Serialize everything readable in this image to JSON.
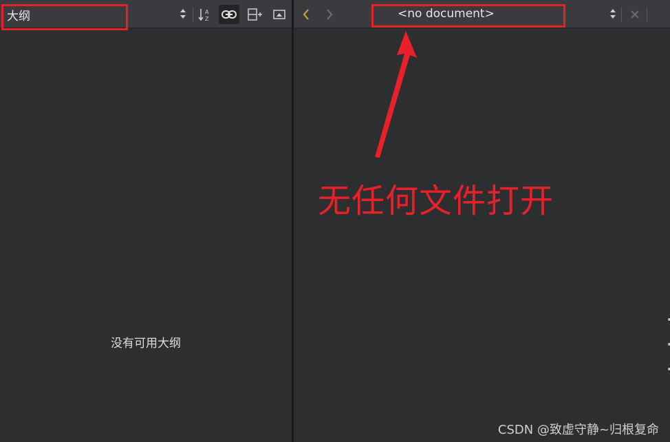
{
  "outline_panel": {
    "title": "大纲",
    "empty_message": "没有可用大纲",
    "toolbar_icons": [
      "sort-alphabetically-icon",
      "link-with-editor-icon",
      "split-add-icon",
      "close-panel-icon"
    ]
  },
  "editor_panel": {
    "document_label": "<no document>",
    "nav_icons": [
      "back-arrow-icon",
      "forward-arrow-icon",
      "close-document-icon"
    ]
  },
  "annotation": {
    "text": "无任何文件打开",
    "color": "#e8202a"
  },
  "watermark": {
    "text": "CSDN @致虚守静~归根复命"
  },
  "colors": {
    "panel_bg": "#2d2e30",
    "toolbar_bg": "#3a3b3e",
    "back_arrow": "#c9a227"
  }
}
